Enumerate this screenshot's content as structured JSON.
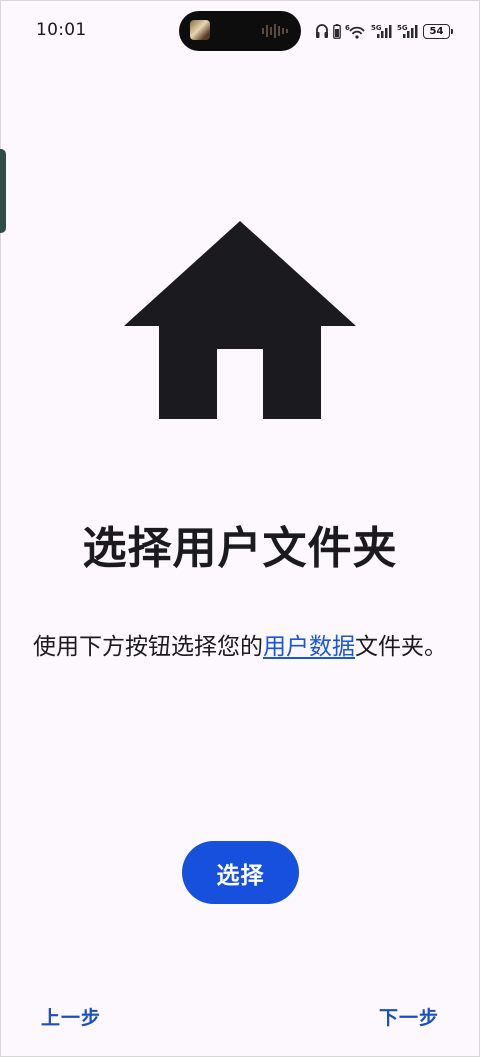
{
  "status_bar": {
    "time": "10:01",
    "battery_level": "54",
    "network_1": "5G",
    "network_2": "5G",
    "icons": [
      "headphones-icon",
      "phone-battery-icon",
      "wifi-icon",
      "signal-icon",
      "signal-icon",
      "battery-icon"
    ]
  },
  "page": {
    "hero_icon": "home-icon",
    "title": "选择用户文件夹",
    "description_before": "使用下方按钮选择您的",
    "description_link": "用户数据",
    "description_after": "文件夹。",
    "select_button": "选择"
  },
  "navigation": {
    "previous_label": "上一步",
    "next_label": "下一步"
  },
  "colors": {
    "background": "#fcf8fd",
    "primary": "#1650dc",
    "link": "#1a56db",
    "text": "#1b1b1f"
  }
}
